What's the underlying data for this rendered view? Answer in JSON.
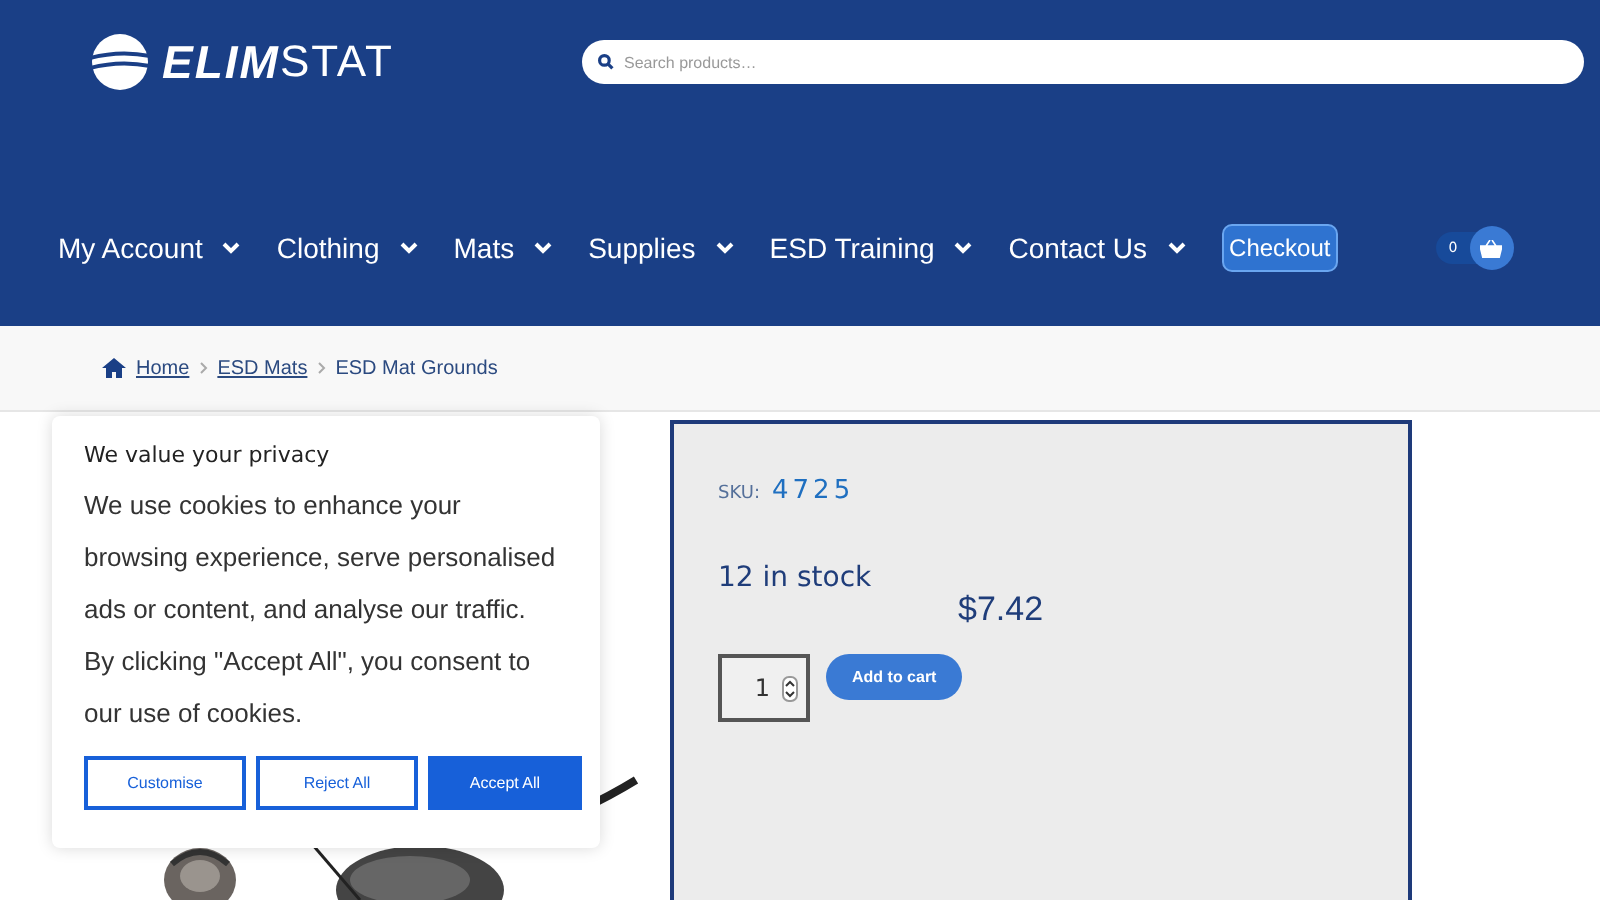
{
  "logo": {
    "bold": "ELIM",
    "light": "STAT"
  },
  "search": {
    "placeholder": "Search products…"
  },
  "nav": [
    {
      "label": "My Account",
      "dropdown": true
    },
    {
      "label": "Clothing",
      "dropdown": true
    },
    {
      "label": "Mats",
      "dropdown": true
    },
    {
      "label": "Supplies",
      "dropdown": true
    },
    {
      "label": "ESD Training",
      "dropdown": true
    },
    {
      "label": "Contact Us",
      "dropdown": true
    }
  ],
  "checkout": "Checkout",
  "cart": {
    "count": "0"
  },
  "breadcrumb": [
    {
      "label": "Home",
      "link": true
    },
    {
      "label": "ESD Mats",
      "link": true
    },
    {
      "label": "ESD Mat Grounds",
      "link": false
    }
  ],
  "product": {
    "sku_label": "SKU:",
    "sku": "4725",
    "stock": "12 in stock",
    "price": "$7.42",
    "quantity": "1",
    "add_button": "Add to cart"
  },
  "cookie": {
    "title": "We value your privacy",
    "text": "We use cookies to enhance your browsing experience, serve personalised ads or content, and analyse our traffic. By clicking \"Accept All\", you consent to our use of cookies.",
    "buttons": [
      {
        "label": "Customise",
        "primary": false
      },
      {
        "label": "Reject All",
        "primary": false
      },
      {
        "label": "Accept All",
        "primary": true
      }
    ]
  }
}
